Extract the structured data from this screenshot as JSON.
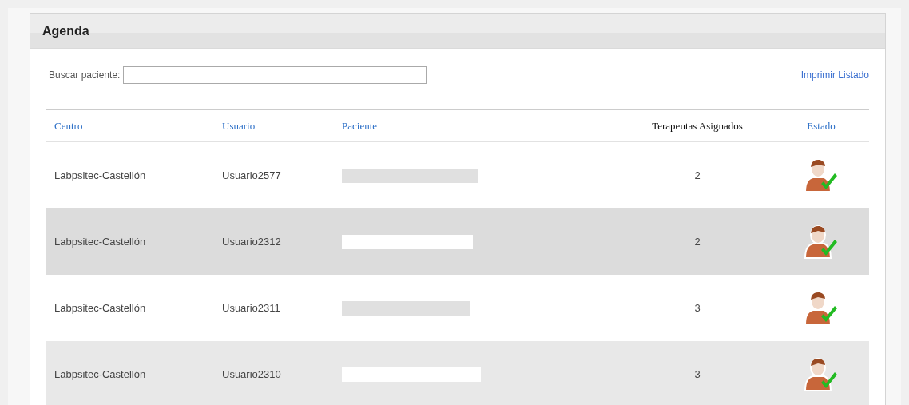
{
  "panel": {
    "title": "Agenda"
  },
  "search": {
    "label": "Buscar paciente:"
  },
  "print_link": "Imprimir Listado",
  "table": {
    "columns": [
      {
        "label": "Centro",
        "link": true
      },
      {
        "label": "Usuario",
        "link": true
      },
      {
        "label": "Paciente",
        "link": true
      },
      {
        "label": "Terapeutas Asignados",
        "link": false
      },
      {
        "label": "Estado",
        "link": true
      }
    ],
    "rows": [
      {
        "centro": "Labpsitec-Castellón",
        "usuario": "Usuario2577",
        "terapeutas": "2"
      },
      {
        "centro": "Labpsitec-Castellón",
        "usuario": "Usuario2312",
        "terapeutas": "2"
      },
      {
        "centro": "Labpsitec-Castellón",
        "usuario": "Usuario2311",
        "terapeutas": "3"
      },
      {
        "centro": "Labpsitec-Castellón",
        "usuario": "Usuario2310",
        "terapeutas": "3"
      }
    ]
  }
}
